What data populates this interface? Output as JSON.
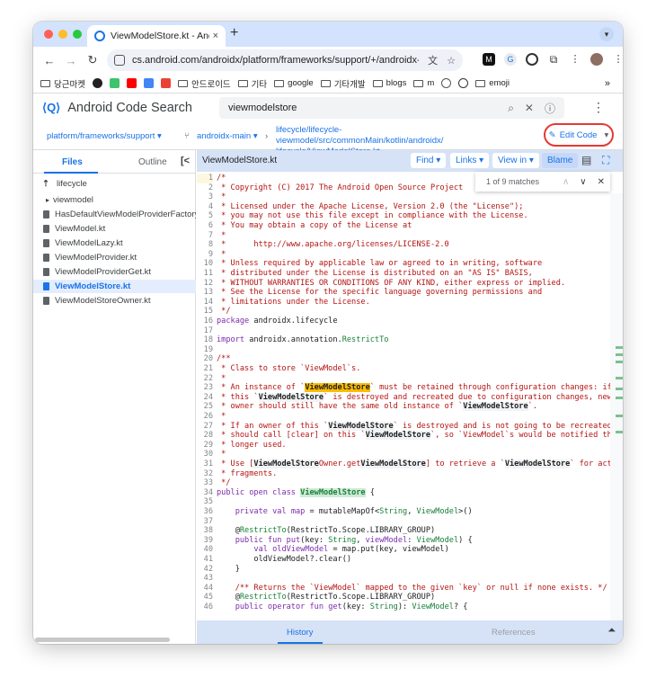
{
  "browser": {
    "tab_title": "ViewModelStore.kt - Android",
    "tab_close": "×",
    "new_tab": "+",
    "url": "cs.android.com/androidx/platform/frameworks/support/+/androidx-main:lifecy...",
    "nav_back": "←",
    "nav_forward": "→",
    "nav_reload": "↻",
    "bookmarks": [
      {
        "label": "당근마켓",
        "type": "folder"
      },
      {
        "label": "",
        "type": "github"
      },
      {
        "label": "",
        "type": "n"
      },
      {
        "label": "",
        "type": "youtube"
      },
      {
        "label": "",
        "type": "cal"
      },
      {
        "label": "",
        "type": "gmail"
      },
      {
        "label": "안드로이드",
        "type": "folder"
      },
      {
        "label": "기타",
        "type": "folder"
      },
      {
        "label": "google",
        "type": "folder"
      },
      {
        "label": "기타개발",
        "type": "folder"
      },
      {
        "label": "blogs",
        "type": "folder"
      },
      {
        "label": "m",
        "type": "folder"
      },
      {
        "label": "",
        "type": "globe"
      },
      {
        "label": "",
        "type": "openai"
      },
      {
        "label": "emoji",
        "type": "folder"
      }
    ],
    "bookmarks_more": "»"
  },
  "cs": {
    "logo": "⟨Q⟩",
    "title": "Android Code Search",
    "search_query": "viewmodelstore",
    "kebab": "⋮"
  },
  "path": {
    "repo": "platform/frameworks/support ▾",
    "branch": "androidx-main ▾",
    "file_path_1": "lifecycle/lifecycle-viewmodel/src/commonMain/kotlin/androidx/",
    "file_path_2": "lifecycle/ViewModelStore.kt",
    "edit_code": "Edit Code"
  },
  "left": {
    "tab_files": "Files",
    "tab_outline": "Outline",
    "collapse": "[<",
    "parent": "lifecycle",
    "folder": "viewmodel",
    "files": [
      "HasDefaultViewModelProviderFactory.an",
      "ViewModel.kt",
      "ViewModelLazy.kt",
      "ViewModelProvider.kt",
      "ViewModelProviderGet.kt",
      "ViewModelStore.kt",
      "ViewModelStoreOwner.kt"
    ],
    "selected_file": "ViewModelStore.kt"
  },
  "editor": {
    "file_name": "ViewModelStore.kt",
    "find": "Find ▾",
    "links": "Links ▾",
    "view_in": "View in ▾",
    "blame": "Blame",
    "find_matches": "1 of 9 matches",
    "line_numbers": [
      "1",
      "2",
      "3",
      "4",
      "5",
      "6",
      "7",
      "8",
      "9",
      "10",
      "11",
      "12",
      "13",
      "14",
      "15",
      "16",
      "17",
      "18",
      "19",
      "20",
      "21",
      "22",
      "23",
      "24",
      "25",
      "26",
      "27",
      "28",
      "29",
      "30",
      "31",
      "32",
      "33",
      "34",
      "35",
      "36",
      "37",
      "38",
      "39",
      "40",
      "41",
      "42",
      "43",
      "44",
      "45",
      "46"
    ]
  },
  "bottom": {
    "history": "History",
    "references": "References"
  }
}
